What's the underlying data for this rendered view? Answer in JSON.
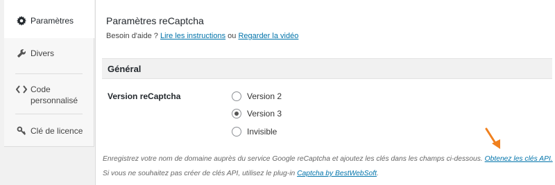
{
  "sidebar": {
    "items": [
      {
        "label": "Paramètres",
        "icon": "gear-icon"
      },
      {
        "label": "Divers",
        "icon": "wrench-icon"
      },
      {
        "label": "Code personnalisé",
        "icon": "code-icon"
      },
      {
        "label": "Clé de licence",
        "icon": "key-icon"
      }
    ]
  },
  "main": {
    "title": "Paramètres reCaptcha",
    "help_prefix": "Besoin d'aide ?",
    "help_link1": "Lire les instructions",
    "help_or": "ou",
    "help_link2": "Regarder la vidéo",
    "section_title": "Général",
    "field_label": "Version reCaptcha",
    "options": [
      "Version 2",
      "Version 3",
      "Invisible"
    ],
    "selected_option": "Version 3",
    "note1_text": "Enregistrez votre nom de domaine auprès du service Google reCaptcha et ajoutez les clés dans les champs ci-dessous.",
    "note1_link": "Obtenez les clés API.",
    "note2_text": "Si vous ne souhaitez pas créer de clés API, utilisez le plug-in",
    "note2_link": "Captcha by BestWebSoft",
    "note2_end": "."
  },
  "colors": {
    "link": "#0073aa",
    "arrow": "#f0801e"
  }
}
